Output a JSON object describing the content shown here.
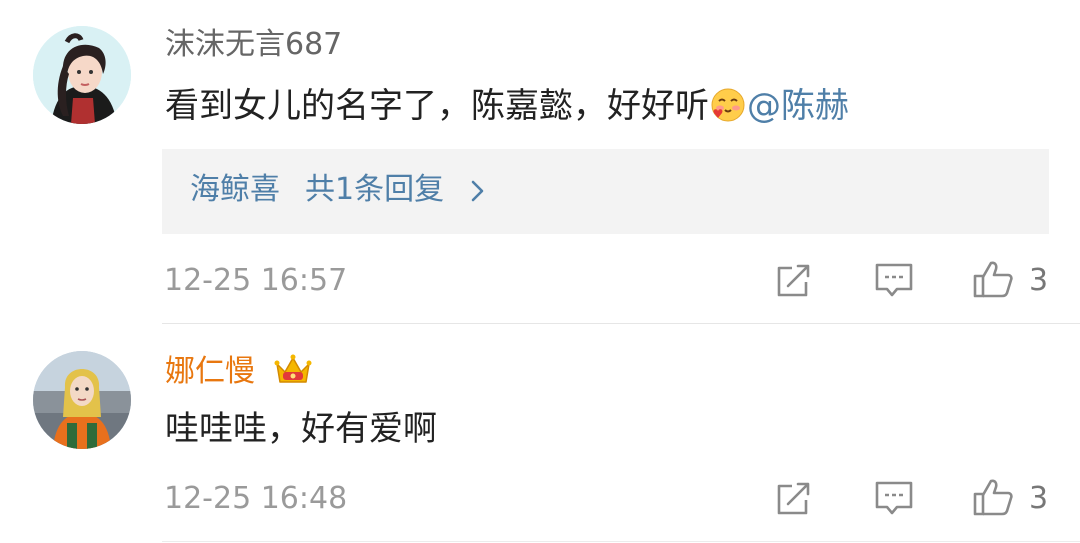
{
  "comments": [
    {
      "username": "沫沫无言687",
      "text": "看到女儿的名字了，陈嘉懿，好好听",
      "emoji": "cute-blush-emoji",
      "mention": "@陈赫",
      "reply_preview": {
        "name": "海鲸喜",
        "count_text": "共1条回复"
      },
      "timestamp": "12-25 16:57",
      "likes": "3"
    },
    {
      "username": "娜仁慢",
      "badge": "crown-icon",
      "text": "哇哇哇，好有爱啊",
      "timestamp": "12-25 16:48",
      "likes": "3"
    }
  ],
  "colors": {
    "username_default": "#666666",
    "username_vip": "#e8770f",
    "mention_link": "#4f7fa8",
    "timestamp": "#9a9a9a",
    "reply_box_bg": "#f3f3f3"
  }
}
